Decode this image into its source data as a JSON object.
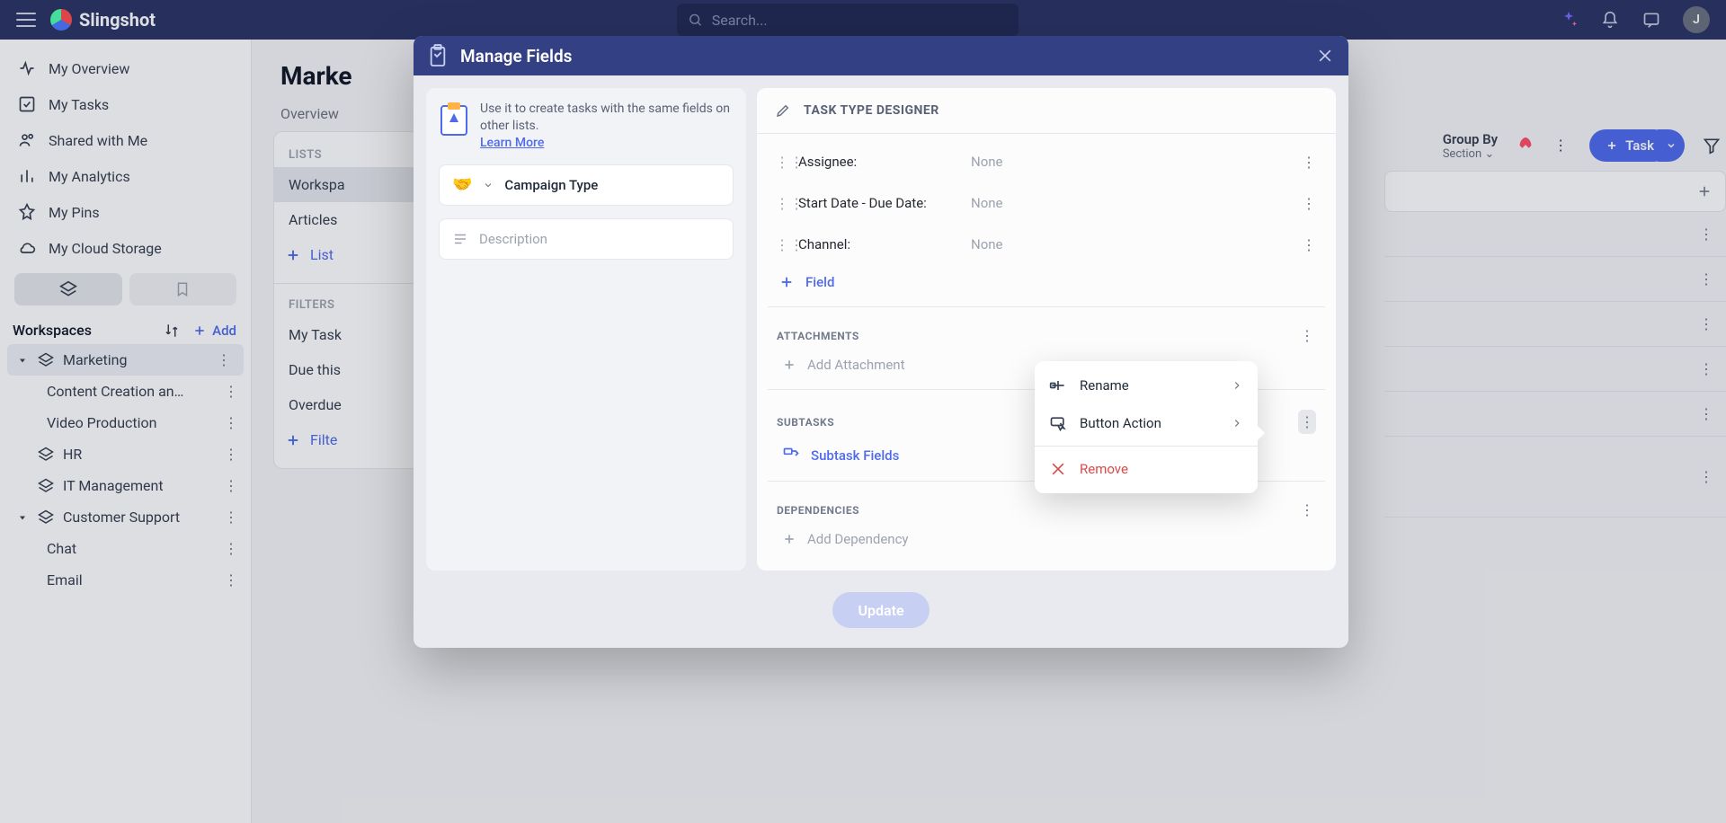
{
  "brand": {
    "name": "Slingshot"
  },
  "search": {
    "placeholder": "Search..."
  },
  "topbar": {
    "avatar_initial": "J"
  },
  "sidebar": {
    "items": [
      {
        "label": "My Overview"
      },
      {
        "label": "My Tasks"
      },
      {
        "label": "Shared with Me"
      },
      {
        "label": "My Analytics"
      },
      {
        "label": "My Pins"
      },
      {
        "label": "My Cloud Storage"
      }
    ],
    "workspaces_label": "Workspaces",
    "add_label": "Add",
    "tree": [
      {
        "label": "Marketing",
        "children": [
          {
            "label": "Content Creation an…"
          },
          {
            "label": "Video Production"
          }
        ]
      },
      {
        "label": "HR"
      },
      {
        "label": "IT Management"
      },
      {
        "label": "Customer Support",
        "children": [
          {
            "label": "Chat"
          },
          {
            "label": "Email"
          }
        ]
      }
    ]
  },
  "main": {
    "title": "Marke",
    "overview_tab": "Overview",
    "lists_panel": {
      "heading": "LISTS",
      "items": [
        "Workspa",
        "Articles"
      ],
      "add": "List"
    },
    "filters_panel": {
      "heading": "FILTERS",
      "items": [
        "My Task",
        "Due this",
        "Overdue"
      ],
      "add": "Filte"
    },
    "right": {
      "groupby_label": "Group By",
      "groupby_value": "Section",
      "task_button": "Task"
    }
  },
  "modal": {
    "title": "Manage Fields",
    "intro_text": "Use it to create tasks with the same fields on other lists.",
    "learn_more": "Learn More",
    "campaign_type": "Campaign Type",
    "description_placeholder": "Description",
    "designer_title": "TASK TYPE DESIGNER",
    "fields": [
      {
        "label": "Assignee:",
        "value": "None"
      },
      {
        "label": "Start Date - Due Date:",
        "value": "None"
      },
      {
        "label": "Channel:",
        "value": "None"
      }
    ],
    "add_field": "Field",
    "attachments_title": "ATTACHMENTS",
    "add_attachment": "Add Attachment",
    "subtasks_title": "SUBTASKS",
    "subtask_fields": "Subtask Fields",
    "dependencies_title": "DEPENDENCIES",
    "add_dependency": "Add Dependency",
    "update_button": "Update"
  },
  "context_menu": {
    "rename": "Rename",
    "button_action": "Button Action",
    "remove": "Remove"
  }
}
